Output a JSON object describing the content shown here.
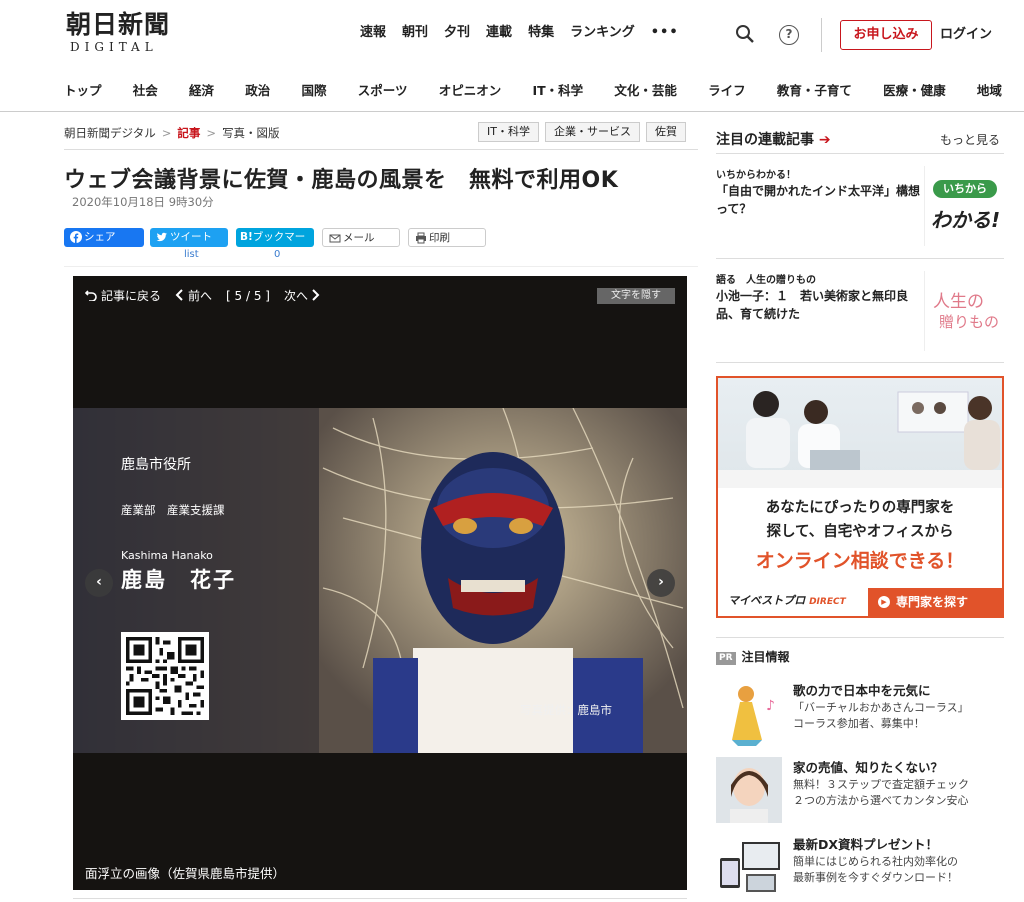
{
  "header": {
    "logo_jp": "朝日新聞",
    "logo_en": "DIGITAL",
    "top_nav": [
      "速報",
      "朝刊",
      "夕刊",
      "連載",
      "特集",
      "ランキング",
      "•••"
    ],
    "help_icon": "?",
    "apply_button": "お申し込み",
    "login_button": "ログイン",
    "categories": [
      "トップ",
      "社会",
      "経済",
      "政治",
      "国際",
      "スポーツ",
      "オピニオン",
      "IT・科学",
      "文化・芸能",
      "ライフ",
      "教育・子育て",
      "医療・健康",
      "地域"
    ]
  },
  "breadcrumb": {
    "home": "朝日新聞デジタル",
    "sep": ">",
    "current": "記事",
    "section": "写真・図版"
  },
  "tags": [
    "IT・科学",
    "企業・サービス",
    "佐賀"
  ],
  "article": {
    "title": "ウェブ会議背景に佐賀・鹿島の風景を　無料で利用OK",
    "date": "2020年10月18日  9時30分"
  },
  "share": {
    "facebook": "シェア",
    "twitter": "ツイート",
    "hatena_icon": "B!",
    "hatena": "ブックマーク",
    "mail": "メール",
    "print": "印刷",
    "twitter_count": "list",
    "hatena_count": "0"
  },
  "viewer": {
    "back": "記事に戻る",
    "prev": "前へ",
    "counter": "[ 5 / 5 ]",
    "next": "次へ",
    "hide_text": "文字を隠す",
    "card_org": "鹿島市役所",
    "card_dept": "産業部　産業支援課",
    "card_roman": "Kashima Hanako",
    "card_name": "鹿島　花子",
    "photo_credit": "写真提供：鹿島市",
    "caption": "面浮立の画像（佐賀県鹿島市提供）"
  },
  "sidebar": {
    "series_title": "注目の連載記事",
    "series_arrow": "➔",
    "more": "もっと見る",
    "series": [
      {
        "kicker": "いちからわかる！",
        "text": "「自由で開かれたインド太平洋」構想って？",
        "thumb_top": "いちから",
        "thumb_bottom": "わかる!"
      },
      {
        "kicker": "語る　人生の贈りもの",
        "text": "小池一子：１　若い美術家と無印良品、育て続けた",
        "thumb_top": "人生の",
        "thumb_bottom": "贈りもの"
      }
    ],
    "ad": {
      "line1": "あなたにぴったりの専門家を",
      "line2": "探して、自宅やオフィスから",
      "line3": "オンライン相談できる！",
      "brand": "マイベストプロ",
      "brand_sub": "DIRECT",
      "cta": "専門家を探す"
    },
    "pr_badge": "PR",
    "pr_title": "注目情報",
    "pr_items": [
      {
        "title": "歌の力で日本中を元気に",
        "desc1": "「バーチャルおかあさんコーラス」",
        "desc2": "コーラス参加者、募集中！"
      },
      {
        "title": "家の売値、知りたくない？",
        "desc1": "無料！３ステップで査定額チェック",
        "desc2": "２つの方法から選べてカンタン安心"
      },
      {
        "title": "最新DX資料プレゼント！",
        "desc1": "簡単にはじめられる社内効率化の",
        "desc2": "最新事例を今すぐダウンロード！"
      }
    ]
  },
  "colors": {
    "accent_red": "#c8161d",
    "ad_orange": "#e1532a",
    "facebook": "#1877f2",
    "twitter": "#1da1f2",
    "hatena": "#00a4de"
  }
}
